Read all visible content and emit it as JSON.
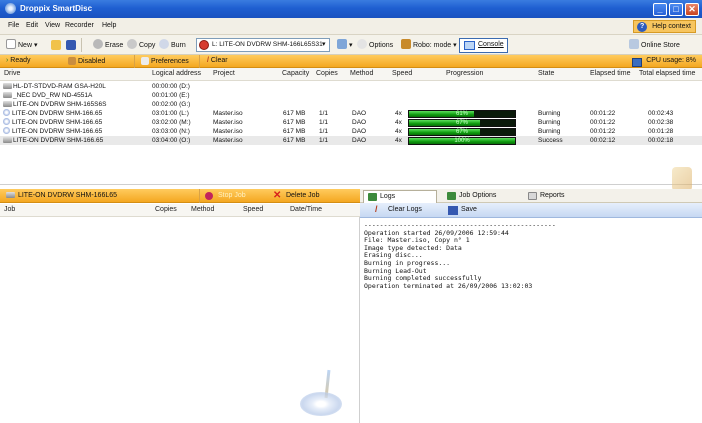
{
  "window": {
    "title": "Droppix SmartDisc"
  },
  "menu": {
    "items": [
      "File",
      "Edit",
      "View",
      "Recorder",
      "Help"
    ],
    "help_context": "Help context"
  },
  "toolbar": {
    "new": "New",
    "erase": "Erase",
    "copy": "Copy",
    "burn": "Burn",
    "device": "L: LITE-ON DVDRW SHM-166L65S31",
    "options": "Options",
    "robo_mode": "Robo: mode",
    "console": "Console",
    "online_store": "Online Store"
  },
  "statusbar": {
    "ready": "Ready",
    "disabled": "Disabled",
    "preferences": "Preferences",
    "clear": "Clear",
    "cpu_usage": "CPU usage: 8%"
  },
  "drives": {
    "columns": [
      "Drive",
      "Logical address",
      "Project",
      "Capacity",
      "Copies",
      "Method",
      "Speed",
      "Progression",
      "State",
      "Elapsed time",
      "Total elapsed time"
    ],
    "rows": [
      {
        "drive": "HL-DT-STDVD-RAM GSA-H20L",
        "address": "00:00:00 (D:)",
        "project": "",
        "capacity": "",
        "copies": "",
        "method": "",
        "speed": "",
        "progress": null,
        "progress_label": "",
        "state": "",
        "elapsed": "",
        "total": "",
        "icon": "drive-icon"
      },
      {
        "drive": "_NEC DVD_RW ND-4551A",
        "address": "00:01:00 (E:)",
        "project": "",
        "capacity": "",
        "copies": "",
        "method": "",
        "speed": "",
        "progress": null,
        "progress_label": "",
        "state": "",
        "elapsed": "",
        "total": "",
        "icon": "drive-icon"
      },
      {
        "drive": "LITE-ON DVDRW SHM-165S6S",
        "address": "00:02:00 (G:)",
        "project": "",
        "capacity": "",
        "copies": "",
        "method": "",
        "speed": "",
        "progress": null,
        "progress_label": "",
        "state": "",
        "elapsed": "",
        "total": "",
        "icon": "drive-icon"
      },
      {
        "drive": "LITE-ON DVDRW SHM-166.65",
        "address": "03:01:00 (L:)",
        "project": "Master.iso",
        "capacity": "617 MB",
        "copies": "1/1",
        "method": "DAO",
        "speed": "4x",
        "progress": 0.61,
        "progress_label": "61%",
        "state": "Burning",
        "elapsed": "00:01:22",
        "total": "00:02:43",
        "icon": "disc-icon"
      },
      {
        "drive": "LITE-ON DVDRW SHM-166.65",
        "address": "03:02:00 (M:)",
        "project": "Master.iso",
        "capacity": "617 MB",
        "copies": "1/1",
        "method": "DAO",
        "speed": "4x",
        "progress": 0.67,
        "progress_label": "67%",
        "state": "Burning",
        "elapsed": "00:01:22",
        "total": "00:02:38",
        "icon": "disc-icon"
      },
      {
        "drive": "LITE-ON DVDRW SHM-166.65",
        "address": "03:03:00 (N:)",
        "project": "Master.iso",
        "capacity": "617 MB",
        "copies": "1/1",
        "method": "DAO",
        "speed": "4x",
        "progress": 0.67,
        "progress_label": "67%",
        "state": "Burning",
        "elapsed": "00:01:22",
        "total": "00:01:28",
        "icon": "disc-icon"
      },
      {
        "drive": "LITE-ON DVDRW SHM-166.65",
        "address": "03:04:00 (O:)",
        "project": "Master.iso",
        "capacity": "617 MB",
        "copies": "1/1",
        "method": "DAO",
        "speed": "4x",
        "progress": 1.0,
        "progress_label": "100%",
        "state": "Success",
        "elapsed": "00:02:12",
        "total": "00:02:18",
        "icon": "drive-icon"
      }
    ]
  },
  "jobs": {
    "drive_label": "LITE-ON DVDRW SHM-166L65",
    "stop_job": "Stop Job",
    "delete_job": "Delete Job",
    "columns": [
      "Job",
      "Copies",
      "Method",
      "Speed",
      "Date/Time"
    ]
  },
  "log": {
    "tabs": [
      "Logs",
      "Job Options",
      "Reports"
    ],
    "clear_logs": "Clear Logs",
    "save": "Save",
    "lines": [
      "-------------------------------------------------",
      "Operation started 26/09/2006 12:59:44",
      "File: Master.iso, Copy n° 1",
      "Image type detected: Data",
      "Erasing disc...",
      "Burning in progress...",
      "Burning Lead-Out",
      "Burning completed successfully",
      "Operation terminated at 26/09/2006 13:02:03"
    ]
  },
  "colors": {
    "accent_orange": "#f4a721",
    "titlebar_blue": "#1f5fd1",
    "progress_green": "#0e9a0e"
  }
}
